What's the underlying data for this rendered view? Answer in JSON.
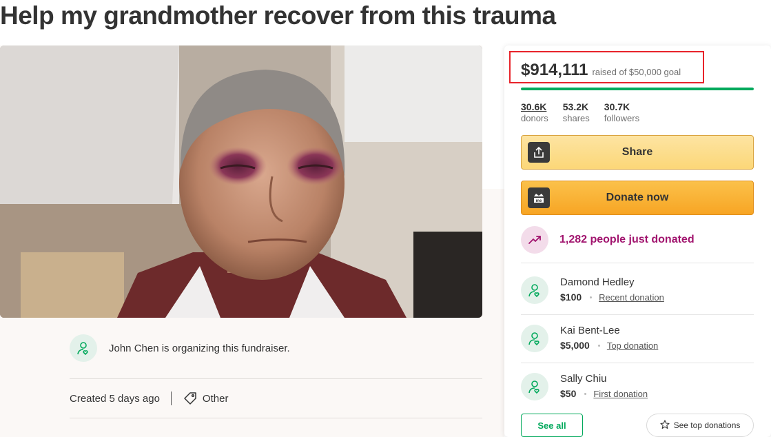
{
  "page": {
    "title": "Help my grandmother recover from this trauma"
  },
  "organizer": {
    "text": "John Chen is organizing this fundraiser.",
    "avatar_icon": "user-heart-icon"
  },
  "meta": {
    "created": "Created 5 days ago",
    "category": "Other",
    "category_icon": "tag-icon"
  },
  "funding": {
    "amount": "$914,111",
    "goal_text": "raised of $50,000 goal",
    "progress_fraction": 1.0,
    "accent_color": "#02a95c"
  },
  "stats": [
    {
      "value": "30.6K",
      "label": "donors"
    },
    {
      "value": "53.2K",
      "label": "shares"
    },
    {
      "value": "30.7K",
      "label": "followers"
    }
  ],
  "buttons": {
    "share_label": "Share",
    "share_icon": "upload-icon",
    "donate_label": "Donate now",
    "donate_icon": "gofundme-logo-icon",
    "see_all_label": "See all",
    "see_top_label": "See top donations",
    "see_top_icon": "star-icon"
  },
  "trend": {
    "text": "1,282 people just donated",
    "icon": "trending-up-icon",
    "color": "#a1146e"
  },
  "donations": [
    {
      "name": "Damond Hedley",
      "amount": "$100",
      "tag": "Recent donation"
    },
    {
      "name": "Kai Bent-Lee",
      "amount": "$5,000",
      "tag": "Top donation"
    },
    {
      "name": "Sally Chiu",
      "amount": "$50",
      "tag": "First donation"
    }
  ]
}
